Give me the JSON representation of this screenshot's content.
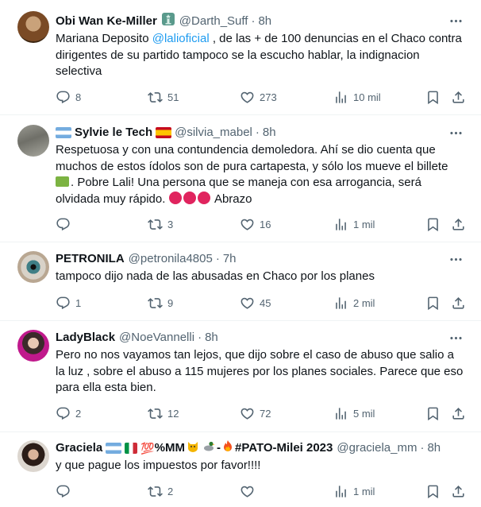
{
  "tweets": [
    {
      "name": "Obi Wan Ke-Miller",
      "handle": "@Darth_Suff",
      "time": "8h",
      "text_before": "Mariana Deposito ",
      "mention": "@lalioficial",
      "text_after": " , de las + de 100 denuncias en el Chaco contra dirigentes de su partido tampoco se la escucho hablar, la indignacion selectiva",
      "replies": "8",
      "retweets": "51",
      "likes": "273",
      "views": "10 mil"
    },
    {
      "name": "Sylvie le Tech",
      "handle": "@silvia_mabel",
      "time": "8h",
      "text_line1": "Respetuosa y con una contundencia demoledora. Ahí se dio cuenta que muchos de estos ídolos son de pura cartapesta, y sólo los mueve el billete",
      "text_line2": ". Pobre Lali! Una persona que se maneja con esa arrogancia, será olvidada muy rápido.",
      "text_line3": "Abrazo",
      "replies": "",
      "retweets": "3",
      "likes": "16",
      "views": "1 mil"
    },
    {
      "name": "PETRONILA",
      "handle": "@petronila4805",
      "time": "7h",
      "text": "tampoco dijo nada de las abusadas en Chaco por los planes",
      "replies": "1",
      "retweets": "9",
      "likes": "45",
      "views": "2 mil"
    },
    {
      "name": "LadyBlack",
      "handle": "@NoeVannelli",
      "time": "8h",
      "text": "Pero no nos vayamos tan lejos, que dijo sobre el caso de abuso que salio a la luz , sobre el abuso a 115 mujeres por los planes sociales. Parece que eso para ella esta bien.",
      "replies": "2",
      "retweets": "12",
      "likes": "72",
      "views": "5 mil"
    },
    {
      "name_part1": "Graciela",
      "name_part2": "%MM",
      "name_part3": "#PATO-Milei 2023",
      "emoji_100": "💯",
      "handle": "@graciela_mm",
      "time": "8h",
      "text": "y que pague los impuestos por favor!!!!",
      "replies": "",
      "retweets": "2",
      "likes": "",
      "views": "1 mil"
    }
  ],
  "colors": {
    "text": "#0f1419",
    "secondary": "#536471",
    "link": "#1d9bf0",
    "divider": "#eff3f4"
  },
  "icons": [
    "reply-icon",
    "retweet-icon",
    "like-icon",
    "views-icon",
    "bookmark-icon",
    "share-icon",
    "more-icon"
  ]
}
